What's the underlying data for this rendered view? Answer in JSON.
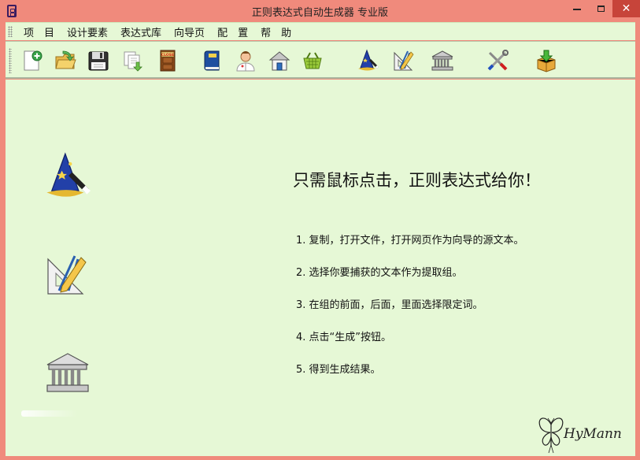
{
  "window": {
    "title": "正则表达式自动生成器 专业版",
    "controls": {
      "minimize": "minimize",
      "maximize": "maximize",
      "close": "✕"
    }
  },
  "menu": {
    "items": [
      {
        "label": "项　目"
      },
      {
        "label": "设计要素"
      },
      {
        "label": "表达式库"
      },
      {
        "label": "向导页"
      },
      {
        "label": "配　置"
      },
      {
        "label": "帮　助"
      }
    ]
  },
  "toolbar": {
    "tools": [
      {
        "icon": "new-document-icon"
      },
      {
        "icon": "open-folder-icon"
      },
      {
        "icon": "save-disk-icon"
      },
      {
        "icon": "copy-pages-icon"
      },
      {
        "icon": "close-door-icon",
        "text": "CLOSE"
      },
      {
        "icon": "book-icon"
      },
      {
        "icon": "doctor-icon"
      },
      {
        "icon": "home-icon"
      },
      {
        "icon": "basket-icon"
      },
      {
        "icon": "wizard-hat-icon"
      },
      {
        "icon": "drafting-tools-icon"
      },
      {
        "icon": "library-building-icon"
      },
      {
        "icon": "tools-icon"
      },
      {
        "icon": "download-box-icon"
      }
    ]
  },
  "main": {
    "headline": "只需鼠标点击，正则表达式给你！",
    "steps": [
      "1. 复制，打开文件，打开网页作为向导的源文本。",
      "2. 选择你要捕获的文本作为提取组。",
      "3. 在组的前面，后面，里面选择限定词。",
      "4. 点击“生成”按钮。",
      "5. 得到生成结果。"
    ],
    "signature": "HyMann"
  },
  "colors": {
    "titlebar": "#f08a7c",
    "content_bg": "#e6f8d6",
    "close_button": "#c7443a"
  }
}
